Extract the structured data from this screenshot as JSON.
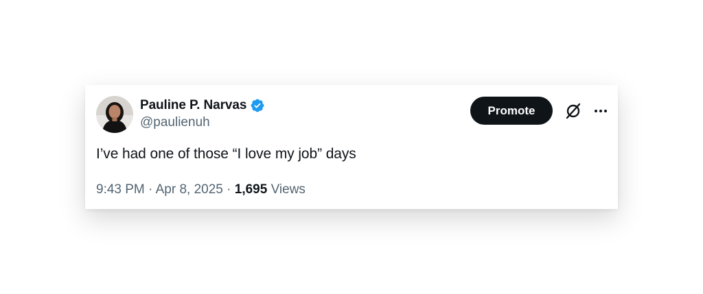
{
  "tweet": {
    "author": {
      "display_name": "Pauline P. Narvas",
      "handle": "@paulienuh",
      "verified": true,
      "verified_color": "#1d9bf0"
    },
    "promote_label": "Promote",
    "text": "I’ve had one of those “I love my job” days",
    "time": "9:43 PM",
    "date": "Apr 8, 2025",
    "separator": "·",
    "views_count": "1,695",
    "views_label": "Views"
  },
  "colors": {
    "text_primary": "#0f1419",
    "text_secondary": "#536471",
    "button_bg": "#0f1419"
  },
  "icons": {
    "verified": "verified-badge-icon",
    "grok": "grok-icon",
    "more": "more-horizontal-icon"
  }
}
